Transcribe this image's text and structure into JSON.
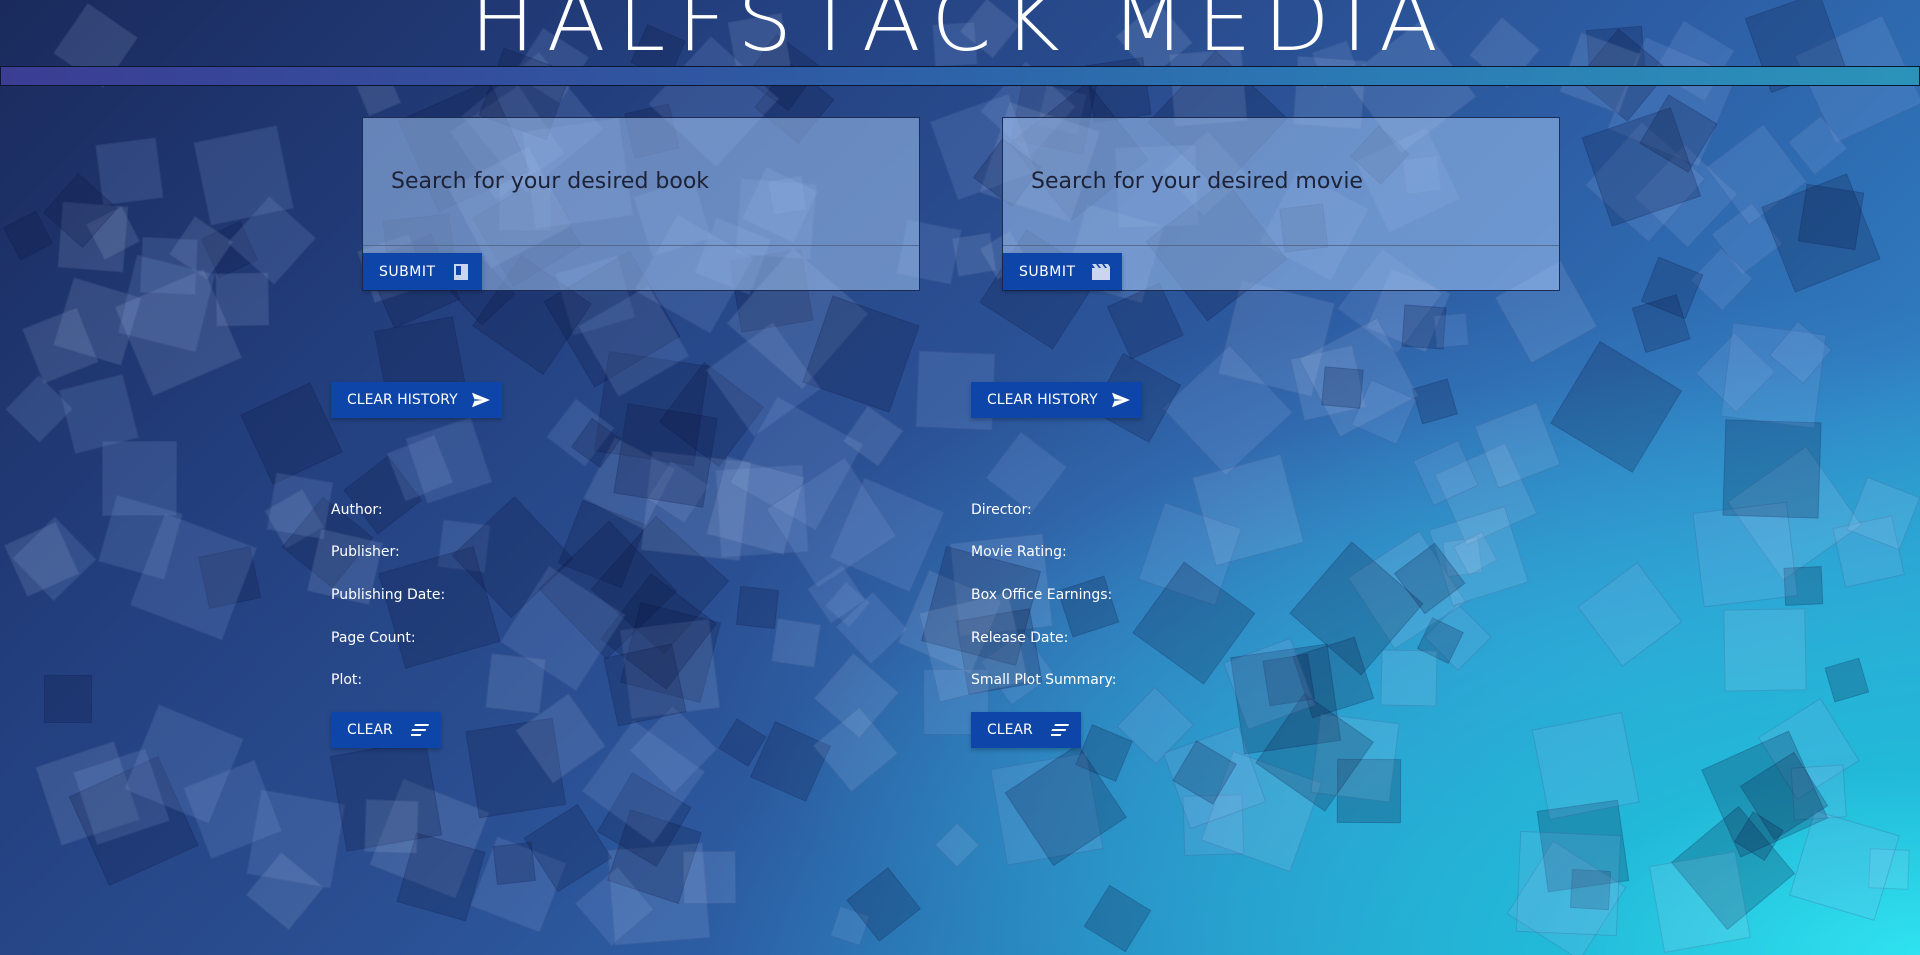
{
  "app": {
    "title": "HALFSTACK MEDIA"
  },
  "book": {
    "search_placeholder": "Search for your desired book",
    "submit_label": "SUBMIT",
    "clear_history_label": "CLEAR HISTORY",
    "fields": [
      "Author:",
      "Publisher:",
      "Publishing Date:",
      "Page Count:",
      "Plot:"
    ],
    "clear_label": "CLEAR"
  },
  "movie": {
    "search_placeholder": "Search for your desired movie",
    "submit_label": "SUBMIT",
    "clear_history_label": "CLEAR HISTORY",
    "fields": [
      "Director:",
      "Movie Rating:",
      "Box Office Earnings:",
      "Release Date:",
      "Small Plot Summary:"
    ],
    "clear_label": "CLEAR"
  },
  "icons": {
    "book_submit": "book-icon",
    "movie_submit": "clapperboard-icon",
    "clear_history": "send-icon",
    "clear": "clear-lines-icon"
  },
  "colors": {
    "button": "#0d46a8",
    "card": "#a0c3f0",
    "text_light": "#ffffff"
  }
}
